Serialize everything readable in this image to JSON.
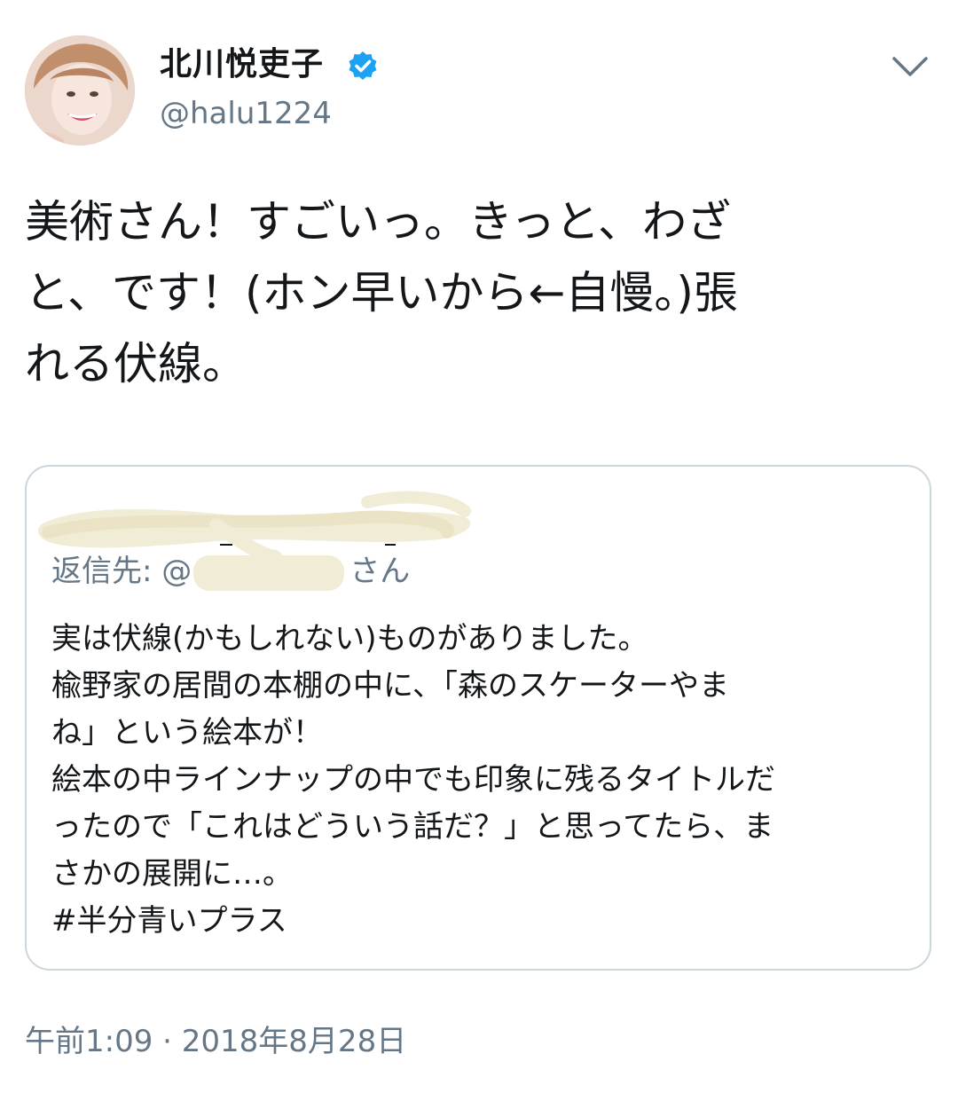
{
  "author": {
    "name": "北川悦吏子",
    "handle": "@halu1224",
    "verified": true,
    "verified_color": "#1da1f2"
  },
  "tweet": {
    "text": "美術さん！すごいっ。きっと、わざ\nと、です！(ホン早いから←自慢。)張\nれる伏線。",
    "timestamp": "午前1:09 · 2018年8月28日"
  },
  "quoted_tweet": {
    "reply_prefix": "返信先: @",
    "reply_suffix": "さん",
    "text": "実は伏線(かもしれない)ものがありました。\n楡野家の居間の本棚の中に、「森のスケーターやま\nね」という絵本が！\n絵本の中ラインナップの中でも印象に残るタイトルだ\nったので「これはどういう話だ？」と思ってたら、ま\nさかの展開に…。\n#半分青いプラス"
  },
  "icons": {
    "verified": "verified-badge-icon",
    "menu": "chevron-down-icon"
  },
  "colors": {
    "text": "#14171a",
    "secondary": "#657786",
    "border": "#ccd6dd",
    "redaction": "#f1ecd6"
  }
}
